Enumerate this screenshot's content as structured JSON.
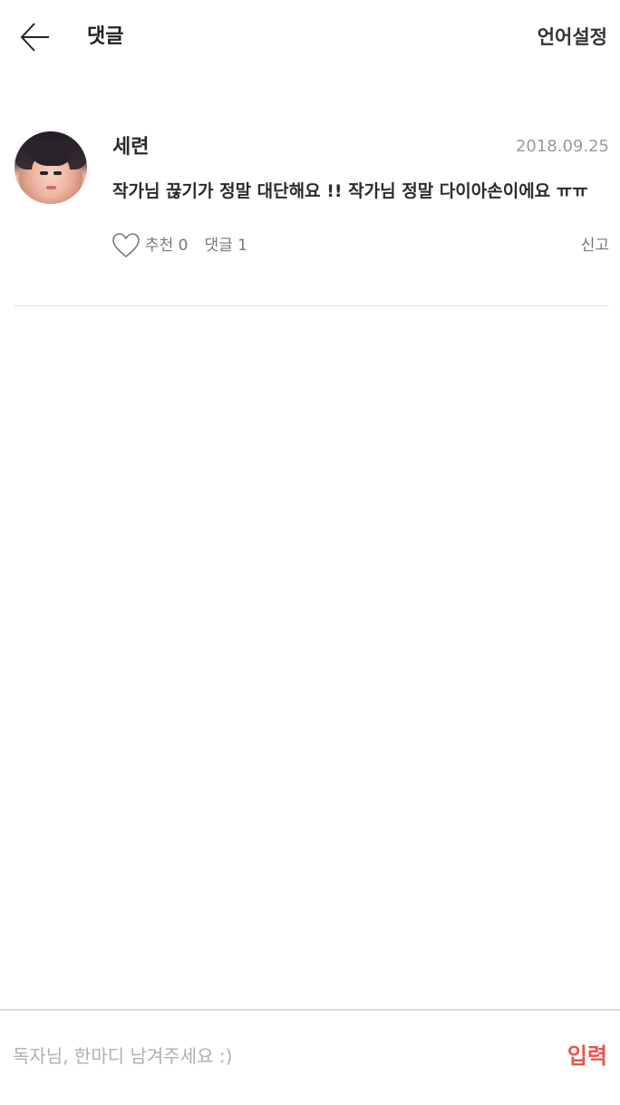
{
  "header": {
    "back_icon": "arrow-left-icon",
    "title": "댓글",
    "language_button": "언어설정"
  },
  "comment": {
    "avatar": "avatar-photo",
    "author": "세련",
    "date": "2018.09.25",
    "text": "작가님 끊기가 정말 대단해요 !! 작가님 정말 다이아손이에요 ㅠㅠ",
    "like_icon": "heart-outline-icon",
    "like_label": "추천 0",
    "reply_label": "댓글 1",
    "report_label": "신고"
  },
  "composer": {
    "placeholder": "독자님, 한마디 남겨주세요 :)",
    "value": "",
    "submit_label": "입력",
    "submit_color": "#e8534a"
  },
  "colors": {
    "accent": "#e8534a",
    "muted_text": "#9a9a9a",
    "divider": "#e2e2e2"
  }
}
